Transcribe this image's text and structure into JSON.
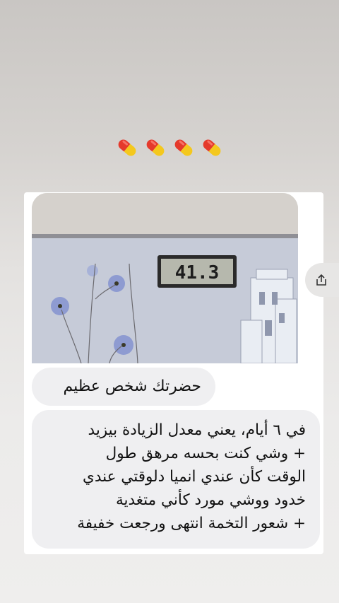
{
  "story": {
    "emoji_row": [
      "pill-icon",
      "pill-icon",
      "pill-icon",
      "pill-icon"
    ],
    "photo": {
      "description_icon": "scale-photo",
      "scale_reading": "41.3"
    },
    "messages": [
      {
        "text": "حضرتك شخص عظيم"
      },
      {
        "lines": [
          "في ٦ أيام، يعني معدل الزيادة بيزيد",
          "+ وشي كنت بحسه مرهق طول",
          "الوقت كأن عندي انميا دلوقتي عندي",
          "خدود ووشي مورد كأني متغدية",
          "+ شعور التخمة انتهى ورجعت خفيفة"
        ]
      }
    ],
    "side_button_icon": "share-icon"
  }
}
